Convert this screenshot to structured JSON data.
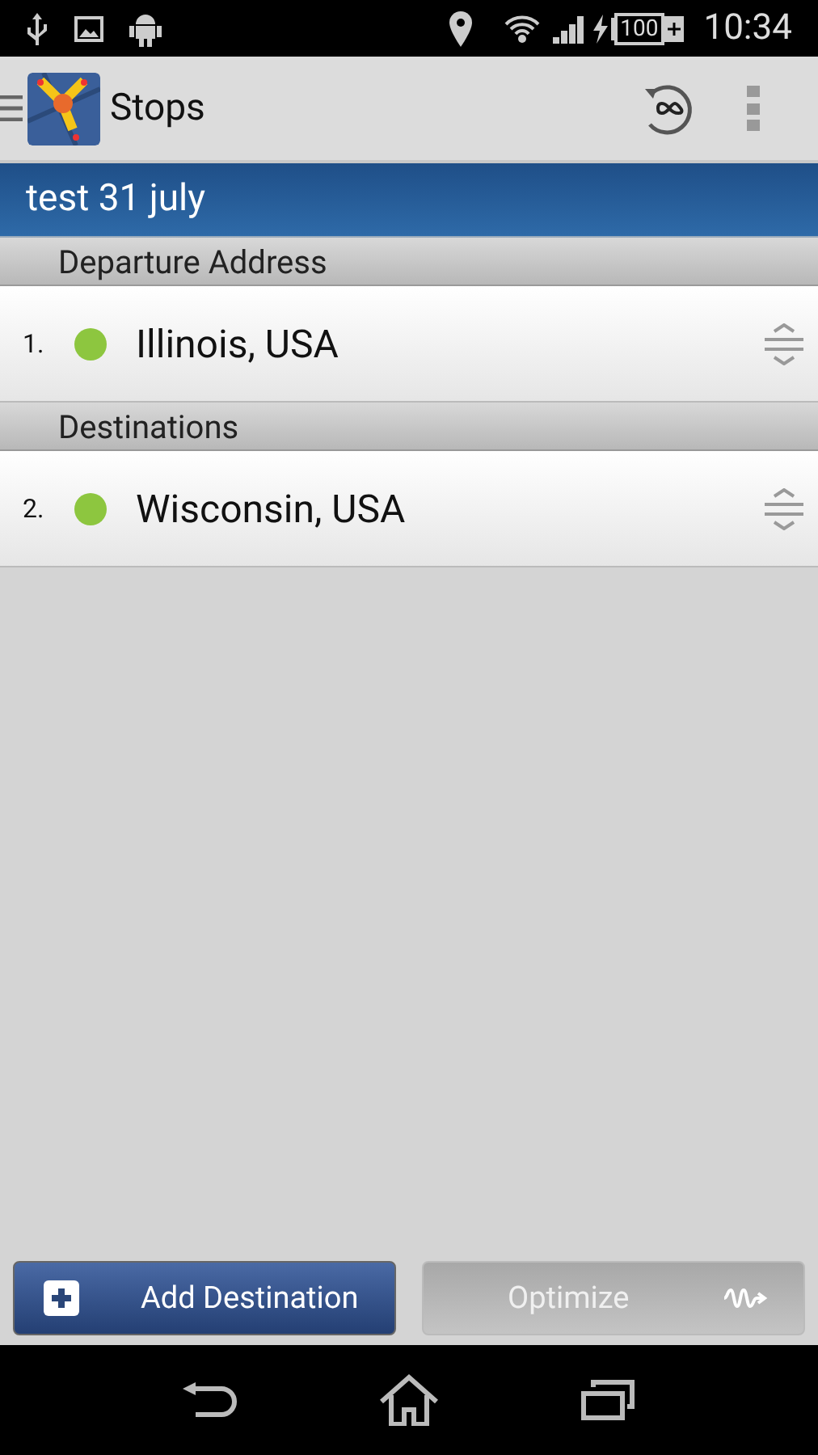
{
  "status_bar": {
    "battery": "100",
    "time": "10:34"
  },
  "action_bar": {
    "title": "Stops"
  },
  "route": {
    "title": "test 31 july"
  },
  "sections": [
    {
      "header": "Departure Address",
      "stops": [
        {
          "number": "1.",
          "address": "Illinois, USA",
          "color": "#8dc63f"
        }
      ]
    },
    {
      "header": "Destinations",
      "stops": [
        {
          "number": "2.",
          "address": "Wisconsin, USA",
          "color": "#8dc63f"
        }
      ]
    }
  ],
  "buttons": [
    {
      "kind": "add",
      "label": "Add Destination",
      "disabled": false
    },
    {
      "kind": "optimize",
      "label": "Optimize",
      "disabled": true
    }
  ]
}
